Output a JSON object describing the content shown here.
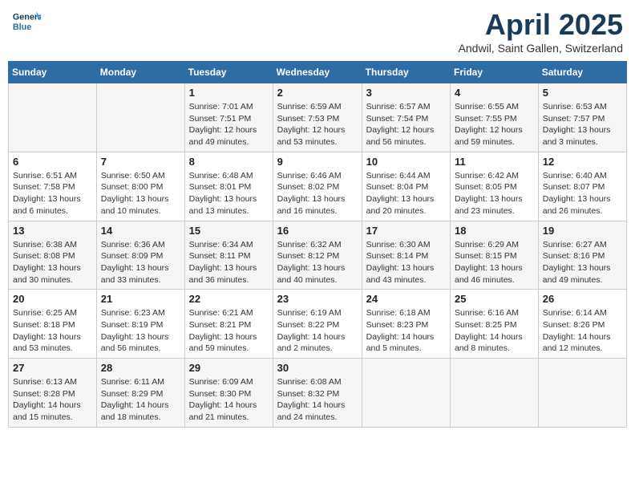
{
  "logo": {
    "line1": "General",
    "line2": "Blue"
  },
  "title": "April 2025",
  "subtitle": "Andwil, Saint Gallen, Switzerland",
  "weekdays": [
    "Sunday",
    "Monday",
    "Tuesday",
    "Wednesday",
    "Thursday",
    "Friday",
    "Saturday"
  ],
  "weeks": [
    [
      {
        "day": "",
        "info": ""
      },
      {
        "day": "",
        "info": ""
      },
      {
        "day": "1",
        "info": "Sunrise: 7:01 AM\nSunset: 7:51 PM\nDaylight: 12 hours\nand 49 minutes."
      },
      {
        "day": "2",
        "info": "Sunrise: 6:59 AM\nSunset: 7:53 PM\nDaylight: 12 hours\nand 53 minutes."
      },
      {
        "day": "3",
        "info": "Sunrise: 6:57 AM\nSunset: 7:54 PM\nDaylight: 12 hours\nand 56 minutes."
      },
      {
        "day": "4",
        "info": "Sunrise: 6:55 AM\nSunset: 7:55 PM\nDaylight: 12 hours\nand 59 minutes."
      },
      {
        "day": "5",
        "info": "Sunrise: 6:53 AM\nSunset: 7:57 PM\nDaylight: 13 hours\nand 3 minutes."
      }
    ],
    [
      {
        "day": "6",
        "info": "Sunrise: 6:51 AM\nSunset: 7:58 PM\nDaylight: 13 hours\nand 6 minutes."
      },
      {
        "day": "7",
        "info": "Sunrise: 6:50 AM\nSunset: 8:00 PM\nDaylight: 13 hours\nand 10 minutes."
      },
      {
        "day": "8",
        "info": "Sunrise: 6:48 AM\nSunset: 8:01 PM\nDaylight: 13 hours\nand 13 minutes."
      },
      {
        "day": "9",
        "info": "Sunrise: 6:46 AM\nSunset: 8:02 PM\nDaylight: 13 hours\nand 16 minutes."
      },
      {
        "day": "10",
        "info": "Sunrise: 6:44 AM\nSunset: 8:04 PM\nDaylight: 13 hours\nand 20 minutes."
      },
      {
        "day": "11",
        "info": "Sunrise: 6:42 AM\nSunset: 8:05 PM\nDaylight: 13 hours\nand 23 minutes."
      },
      {
        "day": "12",
        "info": "Sunrise: 6:40 AM\nSunset: 8:07 PM\nDaylight: 13 hours\nand 26 minutes."
      }
    ],
    [
      {
        "day": "13",
        "info": "Sunrise: 6:38 AM\nSunset: 8:08 PM\nDaylight: 13 hours\nand 30 minutes."
      },
      {
        "day": "14",
        "info": "Sunrise: 6:36 AM\nSunset: 8:09 PM\nDaylight: 13 hours\nand 33 minutes."
      },
      {
        "day": "15",
        "info": "Sunrise: 6:34 AM\nSunset: 8:11 PM\nDaylight: 13 hours\nand 36 minutes."
      },
      {
        "day": "16",
        "info": "Sunrise: 6:32 AM\nSunset: 8:12 PM\nDaylight: 13 hours\nand 40 minutes."
      },
      {
        "day": "17",
        "info": "Sunrise: 6:30 AM\nSunset: 8:14 PM\nDaylight: 13 hours\nand 43 minutes."
      },
      {
        "day": "18",
        "info": "Sunrise: 6:29 AM\nSunset: 8:15 PM\nDaylight: 13 hours\nand 46 minutes."
      },
      {
        "day": "19",
        "info": "Sunrise: 6:27 AM\nSunset: 8:16 PM\nDaylight: 13 hours\nand 49 minutes."
      }
    ],
    [
      {
        "day": "20",
        "info": "Sunrise: 6:25 AM\nSunset: 8:18 PM\nDaylight: 13 hours\nand 53 minutes."
      },
      {
        "day": "21",
        "info": "Sunrise: 6:23 AM\nSunset: 8:19 PM\nDaylight: 13 hours\nand 56 minutes."
      },
      {
        "day": "22",
        "info": "Sunrise: 6:21 AM\nSunset: 8:21 PM\nDaylight: 13 hours\nand 59 minutes."
      },
      {
        "day": "23",
        "info": "Sunrise: 6:19 AM\nSunset: 8:22 PM\nDaylight: 14 hours\nand 2 minutes."
      },
      {
        "day": "24",
        "info": "Sunrise: 6:18 AM\nSunset: 8:23 PM\nDaylight: 14 hours\nand 5 minutes."
      },
      {
        "day": "25",
        "info": "Sunrise: 6:16 AM\nSunset: 8:25 PM\nDaylight: 14 hours\nand 8 minutes."
      },
      {
        "day": "26",
        "info": "Sunrise: 6:14 AM\nSunset: 8:26 PM\nDaylight: 14 hours\nand 12 minutes."
      }
    ],
    [
      {
        "day": "27",
        "info": "Sunrise: 6:13 AM\nSunset: 8:28 PM\nDaylight: 14 hours\nand 15 minutes."
      },
      {
        "day": "28",
        "info": "Sunrise: 6:11 AM\nSunset: 8:29 PM\nDaylight: 14 hours\nand 18 minutes."
      },
      {
        "day": "29",
        "info": "Sunrise: 6:09 AM\nSunset: 8:30 PM\nDaylight: 14 hours\nand 21 minutes."
      },
      {
        "day": "30",
        "info": "Sunrise: 6:08 AM\nSunset: 8:32 PM\nDaylight: 14 hours\nand 24 minutes."
      },
      {
        "day": "",
        "info": ""
      },
      {
        "day": "",
        "info": ""
      },
      {
        "day": "",
        "info": ""
      }
    ]
  ]
}
